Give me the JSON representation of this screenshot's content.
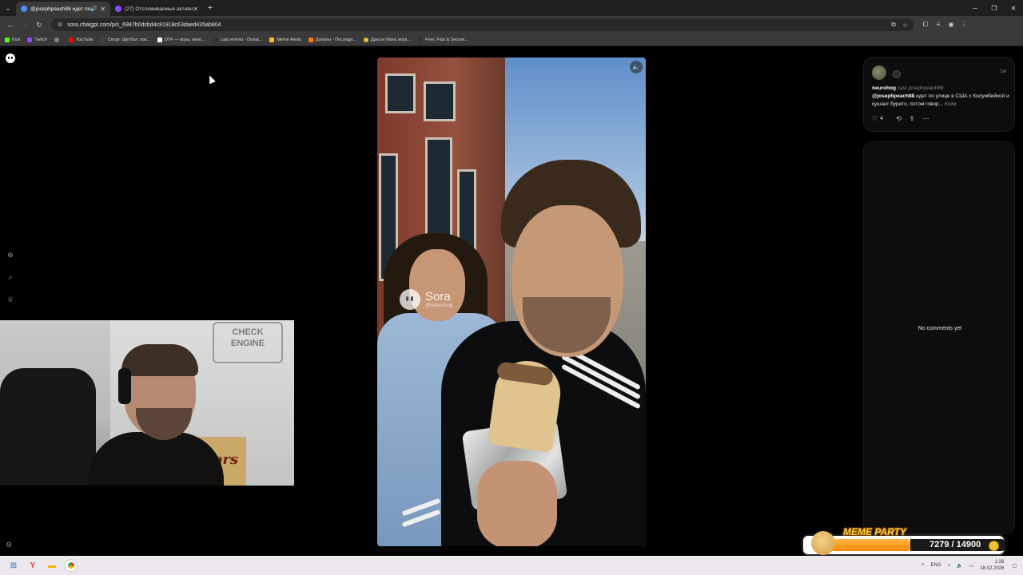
{
  "browser": {
    "tabs": [
      {
        "title": "@josephpeach88 идет по",
        "active": true,
        "audio": true,
        "favicon_color": "#4c8bf5"
      },
      {
        "title": "(27) Отслеживаемые активны",
        "active": false,
        "audio": false,
        "favicon_color": "#9146ff"
      }
    ],
    "url": "sora.chatgpt.com/p/s_6987b0dcbd4c81918c63daed435ab804",
    "bookmarks": [
      {
        "label": "Kick",
        "color": "#53fc18"
      },
      {
        "label": "Twitch",
        "color": "#9146ff"
      },
      {
        "label": "",
        "color": "#888888"
      },
      {
        "label": "YouTube",
        "color": "#ff0000"
      },
      {
        "label": "Спорт: футбол, хок...",
        "color": "#444444"
      },
      {
        "label": "DTF — игры, кино,...",
        "color": "#ffffff"
      },
      {
        "label": "Last events - Donat...",
        "color": "#333333"
      },
      {
        "label": "Meme Alerts",
        "color": "#f4c020"
      },
      {
        "label": "Донаты - Последн...",
        "color": "#ff7a00"
      },
      {
        "label": "Драгон Манс игра...",
        "color": "#e8c030"
      },
      {
        "label": "Free, Fast & Secure...",
        "color": "#333333"
      }
    ]
  },
  "video": {
    "watermark_name": "Sora",
    "watermark_handle": "@neurohog"
  },
  "post": {
    "username": "neurohog",
    "cast_text": "cast josephpeach88",
    "time": "1w",
    "mention": "@josephpeach88",
    "description": " идет по улице в США с Колумбийкой и кушает бурито. потом говор...",
    "more": "more",
    "likes": "4"
  },
  "comments": {
    "empty_text": "No comments yet"
  },
  "webcam": {
    "sign_line1": "CHECK",
    "sign_line2": "ENGINE",
    "box_text": "Coors"
  },
  "meme_party": {
    "title": "MEME PARTY",
    "count": "7279 / 14900",
    "progress": 0.4885
  },
  "taskbar": {
    "lang": "ENG",
    "time": "1:26",
    "date": "18.02.2026"
  }
}
